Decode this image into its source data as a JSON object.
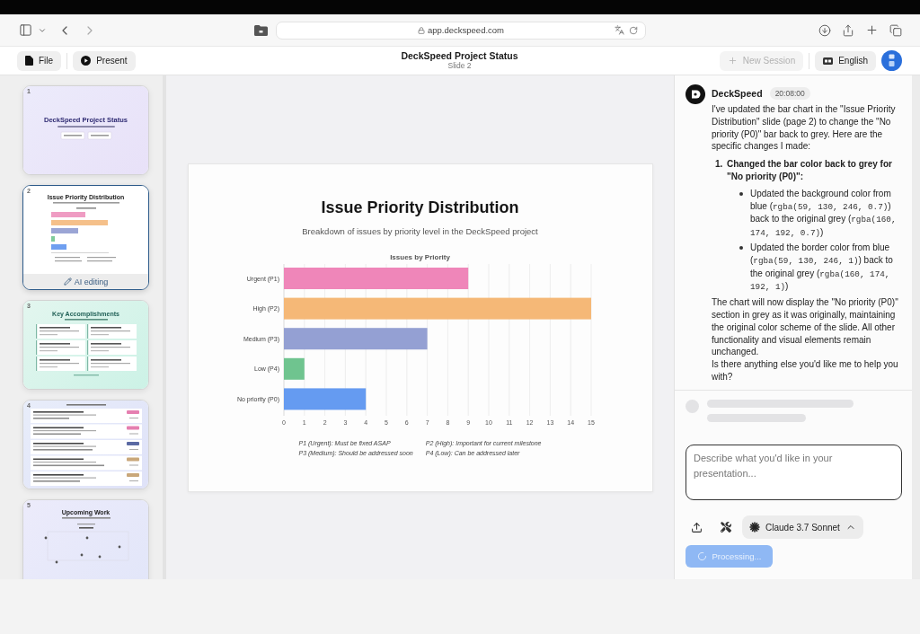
{
  "browser": {
    "url": "app.deckspeed.com"
  },
  "header": {
    "left_buttons": [
      {
        "kind": "file",
        "label": "File"
      },
      {
        "kind": "present",
        "label": "Present"
      }
    ],
    "title": "DeckSpeed Project Status",
    "subtitle": "Slide 2",
    "new_session": {
      "label": "New Session",
      "disabled": true
    },
    "language": {
      "label": "English"
    }
  },
  "slides_panel": {
    "slides": [
      {
        "number": "1",
        "kind": "title",
        "title": "DeckSpeed Project Status",
        "selected": false
      },
      {
        "number": "2",
        "kind": "chart",
        "title": "Issue Priority Distribution",
        "selected": true,
        "badge": "AI editing"
      },
      {
        "number": "3",
        "kind": "cards",
        "title": "Key Accomplishments",
        "selected": false
      },
      {
        "number": "4",
        "kind": "list",
        "selected": false
      },
      {
        "number": "5",
        "kind": "timeline",
        "title": "Upcoming Work",
        "selected": false
      }
    ]
  },
  "slide": {
    "title": "Issue Priority Distribution",
    "subtitle": "Breakdown of issues by priority level in the DeckSpeed project",
    "chart_data": {
      "type": "bar",
      "orientation": "horizontal",
      "title": "Issues by Priority",
      "categories": [
        "Urgent (P1)",
        "High (P2)",
        "Medium (P3)",
        "Low (P4)",
        "No priority (P0)"
      ],
      "series": [
        {
          "colors": [
            "#ef86b9",
            "#f5b877",
            "#94a0d3",
            "#6fc48f",
            "#659bf1"
          ],
          "values": [
            9,
            15,
            7,
            1,
            4
          ]
        }
      ],
      "xlim": [
        0,
        15
      ],
      "xticks": [
        0,
        1,
        2,
        3,
        4,
        5,
        6,
        7,
        8,
        9,
        10,
        11,
        12,
        13,
        14,
        15
      ],
      "grid": true
    },
    "notes": [
      "P1 (Urgent): Must be fixed ASAP",
      "P2 (High): Important for current milestone",
      "P3 (Medium): Should be addressed soon",
      "P4 (Low): Can be addressed later"
    ]
  },
  "chat": {
    "messages": [
      {
        "sender": "DeckSpeed",
        "time": "20:08:00",
        "blocks": [
          {
            "kind": "paragraph",
            "text": "I've updated the bar chart in the \"Issue Priority Distribution\" slide (page 2) to change the \"No priority (P0)\" bar back to grey. Here are the specific changes I made:"
          },
          {
            "kind": "ordered",
            "items": [
              {
                "marker": "1.",
                "text": "Changed the bar color back to grey for \"No priority (P0)\":",
                "bullets": [
                  {
                    "parts": [
                      {
                        "kind": "text",
                        "text": "Updated the background color from blue ("
                      },
                      {
                        "kind": "code",
                        "text": "rgba(59, 130, 246, 0.7)"
                      },
                      {
                        "kind": "text",
                        "text": ") back to the original grey ("
                      },
                      {
                        "kind": "code",
                        "text": "rgba(160, 174, 192, 0.7)"
                      },
                      {
                        "kind": "text",
                        "text": ")"
                      }
                    ]
                  },
                  {
                    "parts": [
                      {
                        "kind": "text",
                        "text": "Updated the border color from blue ("
                      },
                      {
                        "kind": "code",
                        "text": "rgba(59, 130, 246, 1)"
                      },
                      {
                        "kind": "text",
                        "text": ") back to the original grey ("
                      },
                      {
                        "kind": "code",
                        "text": "rgba(160, 174, 192, 1)"
                      },
                      {
                        "kind": "text",
                        "text": ")"
                      }
                    ]
                  }
                ]
              }
            ]
          },
          {
            "kind": "paragraph",
            "text": "The chart will now display the \"No priority (P0)\" section in grey as it was originally, maintaining the original color scheme of the slide. All other functionality and visual elements remain unchanged."
          },
          {
            "kind": "paragraph",
            "text": "Is there anything else you'd like me to help you with?"
          }
        ]
      }
    ],
    "loading": true,
    "input": {
      "placeholder": "Describe what you'd like in your presentation..."
    },
    "model": {
      "label": "Claude 3.7 Sonnet"
    },
    "submit": {
      "label": "Processing...",
      "busy": true
    }
  }
}
